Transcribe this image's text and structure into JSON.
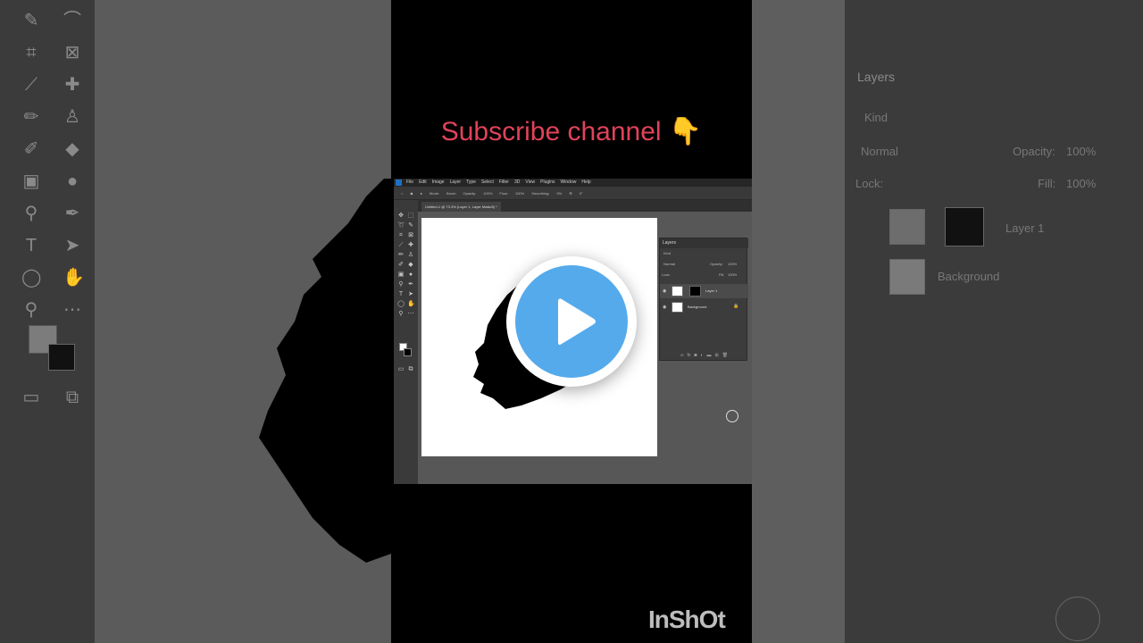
{
  "overlay": {
    "subscribe_text": "Subscribe channel 👇",
    "watermark": "InShOt",
    "accent_color": "#e0435a",
    "play_color": "#55aaec"
  },
  "photoshop": {
    "menu": [
      "File",
      "Edit",
      "Image",
      "Layer",
      "Type",
      "Select",
      "Filter",
      "3D",
      "View",
      "Plugins",
      "Window",
      "Help"
    ],
    "options": {
      "mode_label": "Mode:",
      "mode_value": "Brush",
      "opacity_label": "Opacity:",
      "opacity_value": "100%",
      "flow_label": "Flow:",
      "flow_value": "100%",
      "smoothing_label": "Smoothing:",
      "smoothing_value": "0%",
      "angle_value": "0°"
    },
    "document_tab": "Untitled-1 @ 73.3% (Layer 1, Layer Mask/8) *",
    "layers_panel": {
      "title": "Layers",
      "filter_placeholder": "Kind",
      "blend_mode": "Normal",
      "opacity_label": "Opacity:",
      "opacity_value": "100%",
      "lock_label": "Lock:",
      "fill_label": "Fill:",
      "fill_value": "100%",
      "layers": [
        {
          "name": "Layer 1",
          "selected": true
        },
        {
          "name": "Background",
          "selected": false
        }
      ]
    }
  },
  "bg_right": {
    "title": "Layers",
    "filter_placeholder": "Kind",
    "blend_mode": "Normal",
    "opacity_label": "Opacity:",
    "opacity_value": "100%",
    "lock_label": "Lock:",
    "fill_label": "Fill:",
    "fill_value": "100%",
    "layer1": "Layer 1",
    "background": "Background"
  }
}
